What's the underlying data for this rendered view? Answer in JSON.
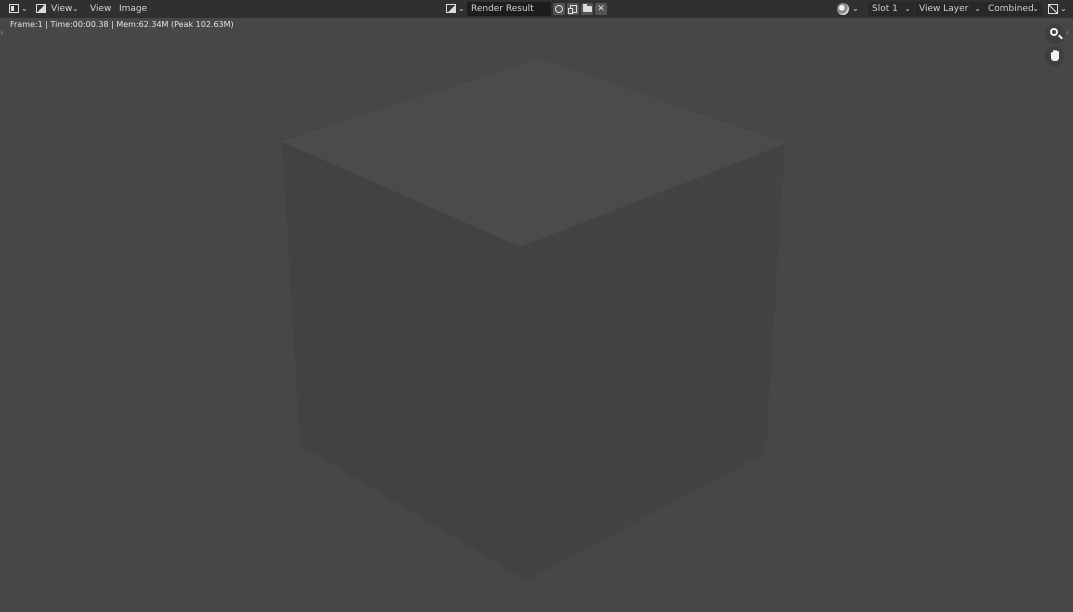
{
  "header": {
    "view_menu": "View",
    "view_menu2": "View",
    "image_menu": "Image",
    "image_name": "Render Result",
    "slot": "Slot 1",
    "view_layer": "View Layer",
    "pass": "Combined"
  },
  "info": {
    "stats": "Frame:1 | Time:00:00.38 | Mem:62.34M (Peak 102.63M)"
  },
  "icons": {
    "editor_type": "image-editor-icon",
    "mode": "view-mode-icon",
    "browse": "image-browse-icon",
    "fake_user": "shield-icon",
    "new_image": "new-image-icon",
    "open_image": "folder-icon",
    "unlink": "close-icon",
    "render_slot": "render-slots-icon",
    "display_channels": "display-channels-icon",
    "zoom": "zoom-icon",
    "pan": "hand-icon"
  },
  "colors": {
    "background": "#474747",
    "header": "#303030",
    "cube_top": "#4a4a4a",
    "cube_left": "#424242",
    "cube_right": "#434343"
  }
}
